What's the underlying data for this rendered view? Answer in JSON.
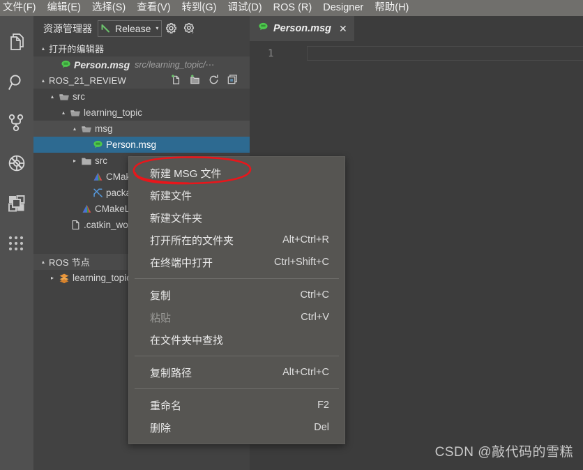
{
  "menubar": {
    "items": [
      {
        "label": "文件(F)",
        "name": "menu-file"
      },
      {
        "label": "编辑(E)",
        "name": "menu-edit"
      },
      {
        "label": "选择(S)",
        "name": "menu-selection"
      },
      {
        "label": "查看(V)",
        "name": "menu-view"
      },
      {
        "label": "转到(G)",
        "name": "menu-go"
      },
      {
        "label": "调试(D)",
        "name": "menu-debug"
      },
      {
        "label": "ROS (R)",
        "name": "menu-ros"
      },
      {
        "label": "Designer",
        "name": "menu-designer"
      },
      {
        "label": "帮助(H)",
        "name": "menu-help"
      }
    ]
  },
  "activitybar": {
    "icons": [
      {
        "name": "explorer-files-icon"
      },
      {
        "name": "search-icon"
      },
      {
        "name": "source-control-icon"
      },
      {
        "name": "run-debug-icon"
      },
      {
        "name": "extensions-icon"
      },
      {
        "name": "more-views-icon"
      }
    ]
  },
  "sidebar": {
    "title": "资源管理器",
    "build": {
      "icon": "hammer-icon",
      "label": "Release",
      "caret": "▾"
    },
    "gear_icons": [
      "settings-gear-icon",
      "settings-gear-sync-icon"
    ],
    "open_editors": {
      "label": "打开的编辑器",
      "twisty": "▴",
      "items": [
        {
          "icon": "msg-file-icon",
          "name": "Person.msg",
          "path": "src/learning_topic/⋯"
        }
      ]
    },
    "workspace": {
      "label": "ROS_21_REVIEW",
      "twisty": "▴",
      "actions": [
        {
          "name": "new-file-icon"
        },
        {
          "name": "new-folder-icon"
        },
        {
          "name": "refresh-icon"
        },
        {
          "name": "collapse-all-icon"
        }
      ],
      "tree": [
        {
          "name": "src",
          "icon": "folder-open-icon",
          "twisty": "▴",
          "indent": 20,
          "state": "normal"
        },
        {
          "name": "learning_topic",
          "icon": "folder-open-icon",
          "twisty": "▴",
          "indent": 36,
          "state": "normal"
        },
        {
          "name": "msg",
          "icon": "folder-open-icon",
          "twisty": "▴",
          "indent": 52,
          "state": "hovered"
        },
        {
          "name": "Person.msg",
          "icon": "msg-file-icon",
          "twisty": "",
          "indent": 68,
          "state": "selected"
        },
        {
          "name": "src",
          "icon": "folder-closed-icon",
          "twisty": "▸",
          "indent": 52,
          "state": "normal"
        },
        {
          "name": "CMakeLists.txt",
          "icon": "cmake-icon",
          "twisty": "",
          "indent": 68,
          "state": "normal"
        },
        {
          "name": "package.xml",
          "icon": "xml-tools-icon",
          "twisty": "",
          "indent": 68,
          "state": "normal"
        },
        {
          "name": "CMakeLists.txt",
          "icon": "cmake-icon",
          "twisty": "",
          "indent": 52,
          "state": "normal"
        },
        {
          "name": ".catkin_workspace",
          "icon": "plain-file-icon",
          "twisty": "",
          "indent": 36,
          "state": "normal"
        }
      ]
    },
    "ros_nodes": {
      "label": "ROS 节点",
      "twisty": "▴",
      "items": [
        {
          "name": "learning_topic",
          "icon": "package-stack-icon",
          "twisty": "▸"
        }
      ]
    }
  },
  "editor": {
    "tab": {
      "icon": "msg-file-icon",
      "label": "Person.msg",
      "close": "✕"
    },
    "line_number": "1"
  },
  "context_menu": {
    "groups": [
      [
        {
          "label": "新建 MSG 文件",
          "key": "",
          "disabled": false,
          "name": "ctx-new-msg-file"
        },
        {
          "label": "新建文件",
          "key": "",
          "disabled": false,
          "name": "ctx-new-file"
        },
        {
          "label": "新建文件夹",
          "key": "",
          "disabled": false,
          "name": "ctx-new-folder"
        },
        {
          "label": "打开所在的文件夹",
          "key": "Alt+Ctrl+R",
          "disabled": false,
          "name": "ctx-reveal-in-explorer"
        },
        {
          "label": "在终端中打开",
          "key": "Ctrl+Shift+C",
          "disabled": false,
          "name": "ctx-open-in-terminal"
        }
      ],
      [
        {
          "label": "复制",
          "key": "Ctrl+C",
          "disabled": false,
          "name": "ctx-copy"
        },
        {
          "label": "粘贴",
          "key": "Ctrl+V",
          "disabled": true,
          "name": "ctx-paste"
        },
        {
          "label": "在文件夹中查找",
          "key": "",
          "disabled": false,
          "name": "ctx-find-in-folder"
        }
      ],
      [
        {
          "label": "复制路径",
          "key": "Alt+Ctrl+C",
          "disabled": false,
          "name": "ctx-copy-path"
        }
      ],
      [
        {
          "label": "重命名",
          "key": "F2",
          "disabled": false,
          "name": "ctx-rename"
        },
        {
          "label": "删除",
          "key": "Del",
          "disabled": false,
          "name": "ctx-delete"
        }
      ]
    ]
  },
  "annotation": {
    "shape": "red-ellipse",
    "color": "#e8161b",
    "target": "新建 MSG 文件"
  },
  "watermark": {
    "text": "CSDN @敲代码的雪糕"
  },
  "colors": {
    "menubar_bg": "#706f6c",
    "activitybar_bg": "#505050",
    "sidebar_bg": "#424242",
    "editor_bg": "#3c3c3c",
    "selection_blue": "#2d6a91",
    "context_menu_bg": "#565552",
    "accent_green": "#6cc26c",
    "annotation_red": "#e8161b"
  }
}
